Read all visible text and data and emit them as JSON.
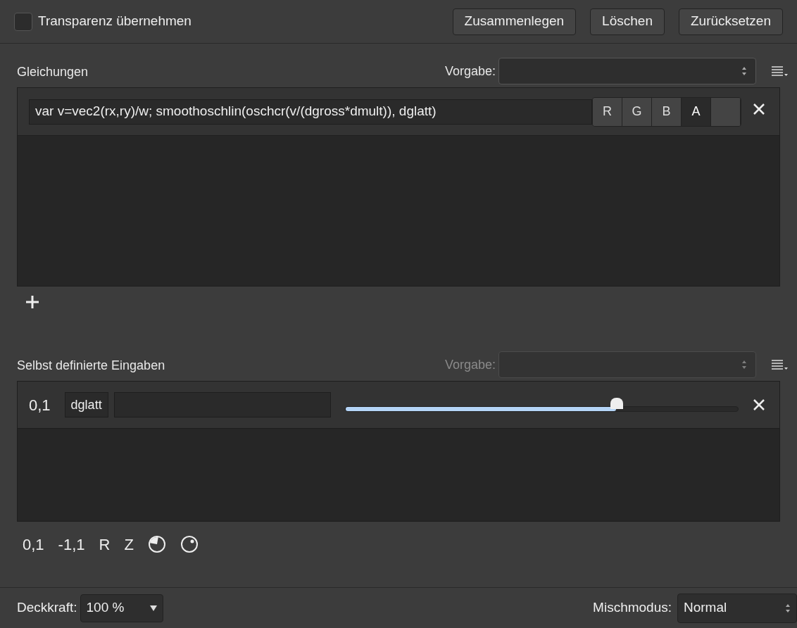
{
  "transparency": {
    "label": "Transparenz übernehmen",
    "checked": false
  },
  "top_buttons": [
    "Zusammenlegen",
    "Löschen",
    "Zurücksetzen"
  ],
  "equations": {
    "title": "Gleichungen",
    "preset_label": "Vorgabe:",
    "preset_disabled": false,
    "rows": [
      {
        "formula": "var v=vec2(rx,ry)/w; smoothoschlin(oschcr(v/(dgross*dmult)), dglatt)",
        "channels": [
          {
            "label": "R",
            "selected": false
          },
          {
            "label": "G",
            "selected": false
          },
          {
            "label": "B",
            "selected": false
          },
          {
            "label": "A",
            "selected": true
          },
          {
            "selected": false
          }
        ]
      }
    ]
  },
  "inputs": {
    "title": "Selbst definierte Eingaben",
    "preset_label": "Vorgabe:",
    "preset_disabled": true,
    "rows": [
      {
        "value": "0,1",
        "name": "dglatt",
        "level": 0.69
      }
    ],
    "types": [
      {
        "kind": "text",
        "label": "0,1"
      },
      {
        "kind": "text",
        "label": "-1,1"
      },
      {
        "kind": "text",
        "label": "R"
      },
      {
        "kind": "text",
        "label": "Z"
      },
      {
        "kind": "pie"
      },
      {
        "kind": "dial"
      }
    ]
  },
  "footer": {
    "opacity_label": "Deckkraft:",
    "opacity_value": "100 %",
    "blend_label": "Mischmodus:",
    "blend_value": "Normal"
  }
}
